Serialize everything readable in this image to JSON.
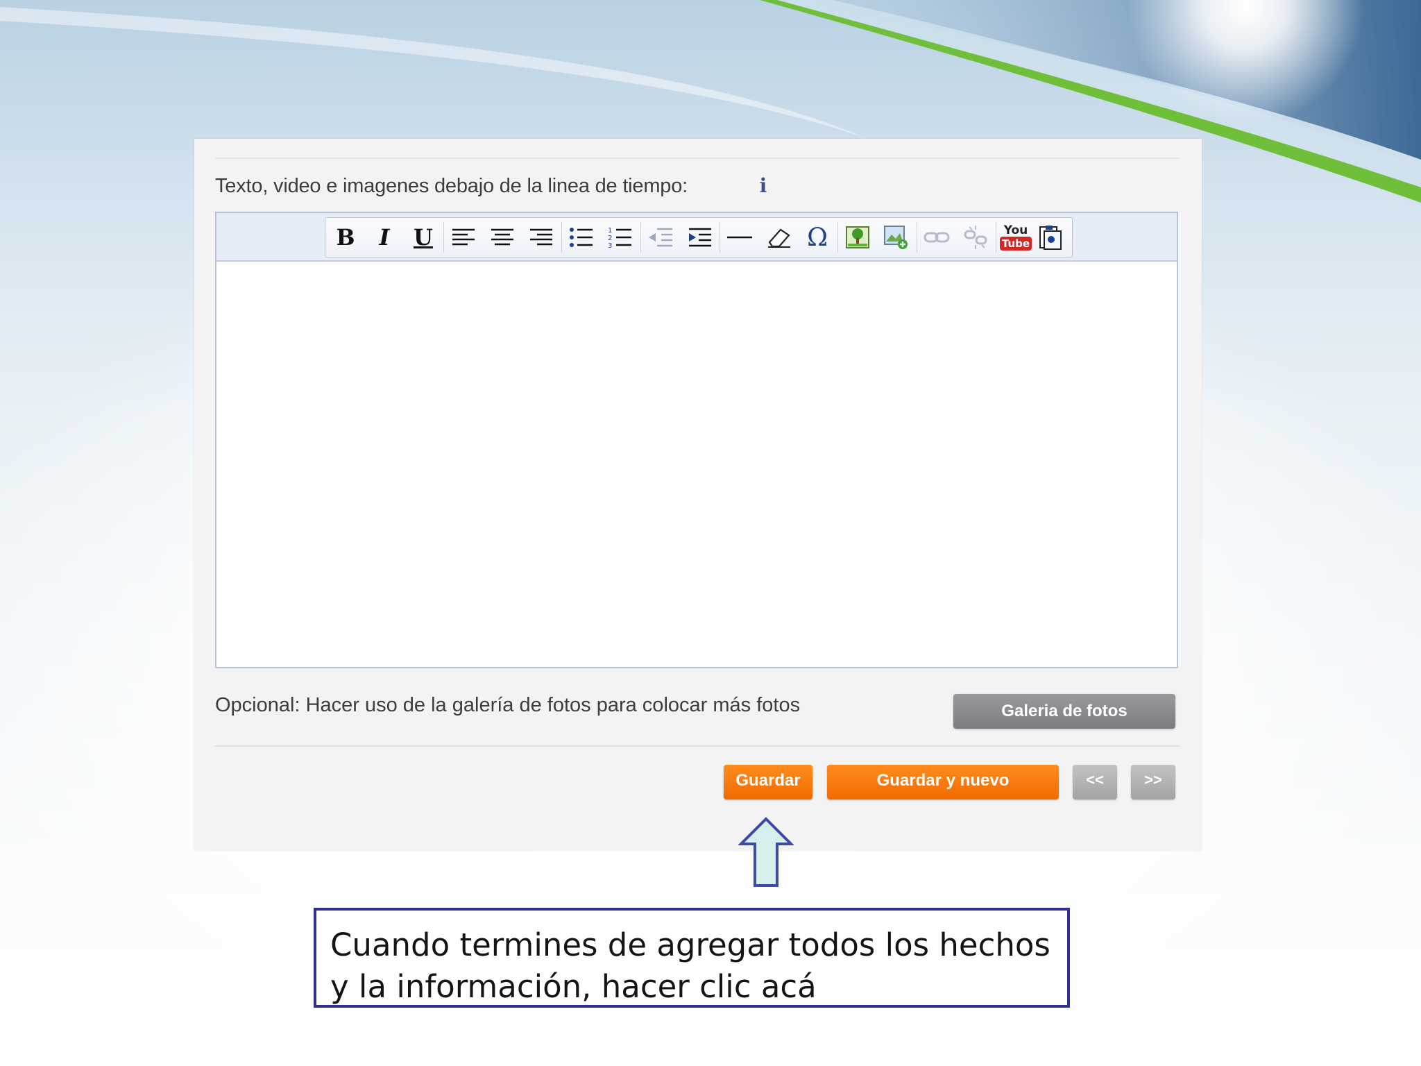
{
  "editor_section": {
    "label": "Texto, video e imagenes debajo de la linea de tiempo:",
    "info_icon_glyph": "i",
    "toolbar": {
      "bold": "B",
      "italic": "I",
      "underline": "U",
      "special_char": "Ω",
      "youtube_top": "You",
      "youtube_bottom": "Tube",
      "buttons": [
        "bold-icon",
        "italic-icon",
        "underline-icon",
        "align-left-icon",
        "align-center-icon",
        "align-right-icon",
        "bulleted-list-icon",
        "numbered-list-icon",
        "outdent-icon",
        "indent-icon",
        "horizontal-rule-icon",
        "eraser-icon",
        "omega-icon",
        "image-icon",
        "insert-image-icon",
        "link-icon",
        "unlink-icon",
        "youtube-icon",
        "paste-icon"
      ]
    },
    "content": ""
  },
  "gallery": {
    "text": "Opcional: Hacer uso de la galería de fotos para colocar más fotos",
    "button": "Galeria de fotos"
  },
  "actions": {
    "save": "Guardar",
    "save_new": "Guardar y nuevo",
    "prev": "<<",
    "next": ">>"
  },
  "callout": {
    "text": "Cuando termines de agregar todos los hechos\ny la información, hacer clic acá"
  },
  "colors": {
    "accent_orange": "#f77f10",
    "gallery_gray": "#8a8a8e",
    "callout_border": "#2e3192",
    "arrow_fill": "#d6efec",
    "arrow_stroke": "#3d4aa8"
  }
}
